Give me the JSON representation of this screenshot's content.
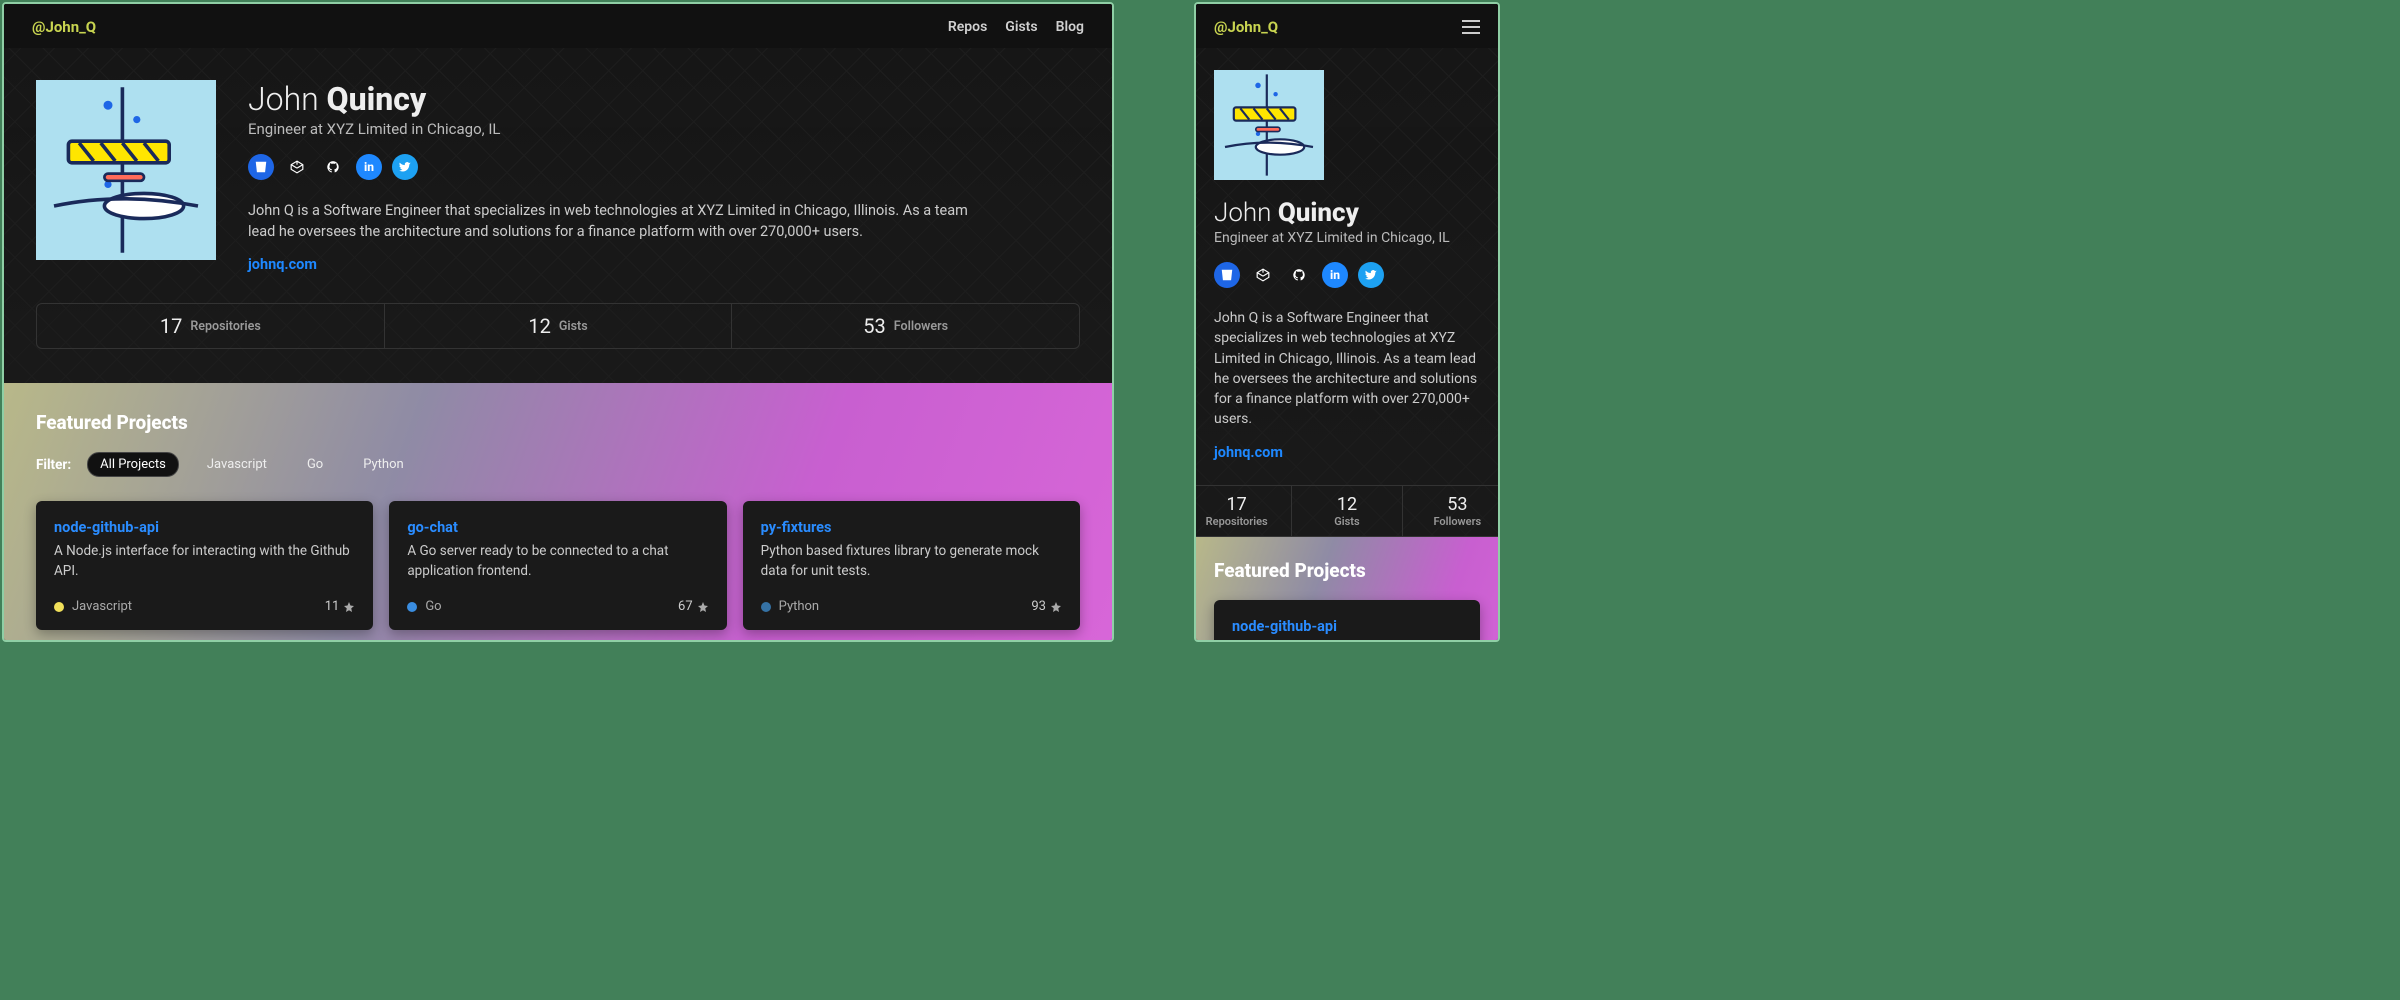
{
  "nav": {
    "handle": "@John_Q",
    "links": [
      "Repos",
      "Gists",
      "Blog"
    ]
  },
  "profile": {
    "first_name": "John",
    "last_name": "Quincy",
    "tagline": "Engineer at XYZ Limited in Chicago, IL",
    "bio": "John Q is a Software Engineer that specializes in web technologies at XYZ Limited in Chicago, Illinois. As a team lead he oversees the architecture and solutions for a finance platform with over 270,000+ users.",
    "website": "johnq.com"
  },
  "socials": [
    {
      "name": "bitbucket",
      "bg": "#1e66e6",
      "fg": "#fff"
    },
    {
      "name": "codepen",
      "bg": "#111",
      "fg": "#fff"
    },
    {
      "name": "github",
      "bg": "#111",
      "fg": "#fff"
    },
    {
      "name": "linkedin",
      "bg": "#1e88ff",
      "fg": "#fff"
    },
    {
      "name": "twitter",
      "bg": "#1da1f2",
      "fg": "#fff"
    }
  ],
  "stats": [
    {
      "value": "17",
      "label": "Repositories"
    },
    {
      "value": "12",
      "label": "Gists"
    },
    {
      "value": "53",
      "label": "Followers"
    }
  ],
  "featured": {
    "heading": "Featured Projects",
    "filter_label": "Filter:",
    "filters": [
      {
        "label": "All Projects",
        "active": true
      },
      {
        "label": "Javascript",
        "active": false
      },
      {
        "label": "Go",
        "active": false
      },
      {
        "label": "Python",
        "active": false
      }
    ],
    "projects": [
      {
        "title": "node-github-api",
        "desc": "A Node.js interface for interacting with the Github API.",
        "lang": "Javascript",
        "color": "#f1e05a",
        "stars": "11"
      },
      {
        "title": "go-chat",
        "desc": "A Go server ready to be connected to a chat application frontend.",
        "lang": "Go",
        "color": "#3a8de0",
        "stars": "67"
      },
      {
        "title": "py-fixtures",
        "desc": "Python based fixtures library to generate mock data for unit tests.",
        "lang": "Python",
        "color": "#3572A5",
        "stars": "93"
      }
    ]
  }
}
